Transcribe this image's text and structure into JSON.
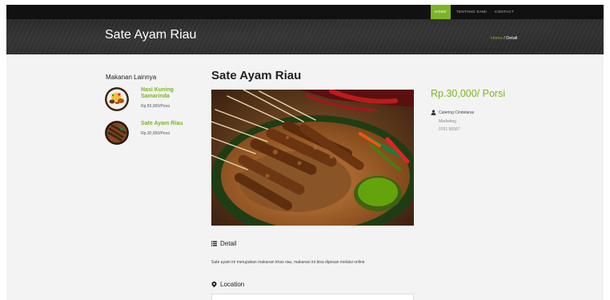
{
  "nav": {
    "items": [
      "Home",
      "Tentang Kami",
      "Contact"
    ],
    "active_index": 0
  },
  "hero": {
    "title": "Sate Ayam Riau",
    "breadcrumb_home": "Home",
    "breadcrumb_sep": " / ",
    "breadcrumb_current": "Detail"
  },
  "sidebar": {
    "title": "Makanan Lainnya",
    "items": [
      {
        "name": "Nasi Kuning Samarinda",
        "price": "Rp.50,000/Porsi"
      },
      {
        "name": "Sate Ayam Riau",
        "price": "Rp.30,000/Porsi"
      }
    ]
  },
  "main": {
    "title": "Sate Ayam Riau",
    "detail_heading": "Detail",
    "description": "Sate ayam ini merupakan makanan khas riau, makanan ini bisa dipesan melalui online",
    "location_heading": "Location"
  },
  "info": {
    "price": "Rp.30,000/ Porsi",
    "vendor": "Catering Cindelaras",
    "role": "Marketing",
    "phone": "0761 56567"
  },
  "colors": {
    "accent": "#7db425",
    "nav_bg": "#111111",
    "hero_bg": "#2d2d2d",
    "page_bg": "#f3f3f3"
  }
}
